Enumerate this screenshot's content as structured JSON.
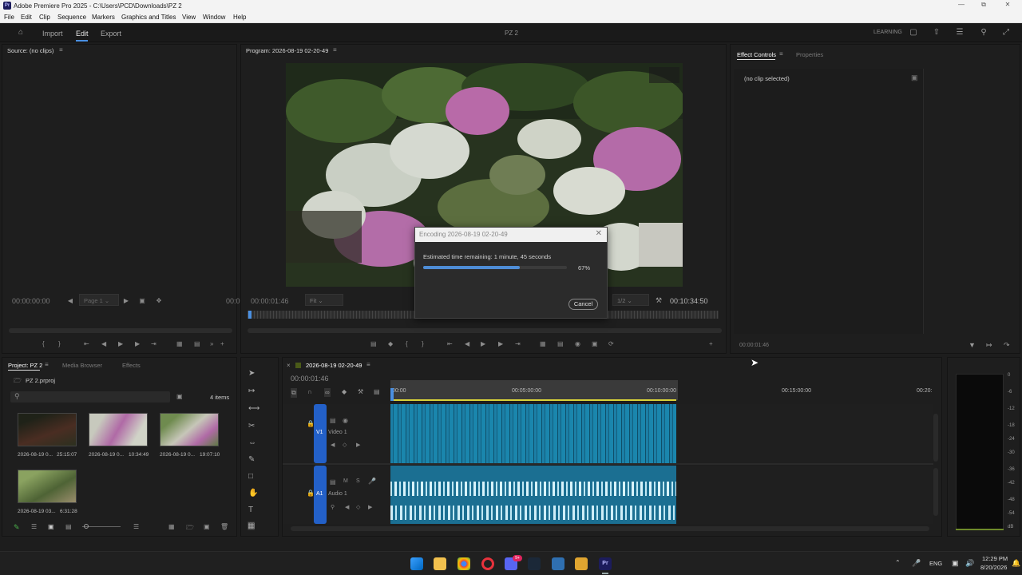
{
  "window": {
    "title": "Adobe Premiere Pro 2025 - C:\\Users\\PCD\\Downloads\\PZ 2",
    "logo_text": "Pr"
  },
  "menu": [
    "File",
    "Edit",
    "Clip",
    "Sequence",
    "Markers",
    "Graphics and Titles",
    "View",
    "Window",
    "Help"
  ],
  "header": {
    "workspaces": [
      "Import",
      "Edit",
      "Export"
    ],
    "active": "Edit",
    "project_name": "PZ 2",
    "learning": "LEARNING"
  },
  "source_panel": {
    "title": "Source: (no clips)",
    "timecode": "00:00:00:00",
    "page": "Page 1",
    "timecode_right": "00:0"
  },
  "program_panel": {
    "title": "Program: 2026-08-19 02-20-49",
    "timecode": "00:00:01:46",
    "fit": "Fit",
    "quality": "1/2",
    "duration": "00:10:34:50"
  },
  "effect_controls": {
    "tab_active": "Effect Controls",
    "tab_other": "Properties",
    "no_clip": "(no clip selected)",
    "timecode": "00:00:01:46"
  },
  "dialog": {
    "title": "Encoding 2026-08-19 02-20-49",
    "message": "Estimated time remaining: 1 minute, 45 seconds",
    "percent_label": "67%",
    "progress": 0.67,
    "cancel": "Cancel"
  },
  "project_panel": {
    "tabs": [
      "Project: PZ 2",
      "Media Browser",
      "Effects"
    ],
    "file": "PZ 2.prproj",
    "items_count": "4 items",
    "clips": [
      {
        "name": "2026-08-19 0...",
        "duration": "25:15:07"
      },
      {
        "name": "2026-08-19 0...",
        "duration": "10:34:49"
      },
      {
        "name": "2026-08-19 0...",
        "duration": "19:07:10"
      },
      {
        "name": "2026-08-19 03...",
        "duration": "6:31:28"
      }
    ]
  },
  "timeline": {
    "sequence": "2026-08-19 02-20-49",
    "timecode": "00:00:01:46",
    "ruler": [
      "00:00",
      "00:05:00:00",
      "00:10:00:00",
      "00:15:00:00",
      "00:20:"
    ],
    "video_track": {
      "id": "V1",
      "name": "Video 1"
    },
    "audio_track": {
      "id": "A1",
      "name": "Audio 1",
      "m": "M",
      "s": "S"
    }
  },
  "meter_labels": [
    "0",
    "-6",
    "-12",
    "-18",
    "-24",
    "-30",
    "-36",
    "-42",
    "-48",
    "-54",
    "dB"
  ],
  "taskbar": {
    "lang": "ENG",
    "time": "12:29 PM",
    "date": "8/20/2026",
    "badge": "9+"
  }
}
